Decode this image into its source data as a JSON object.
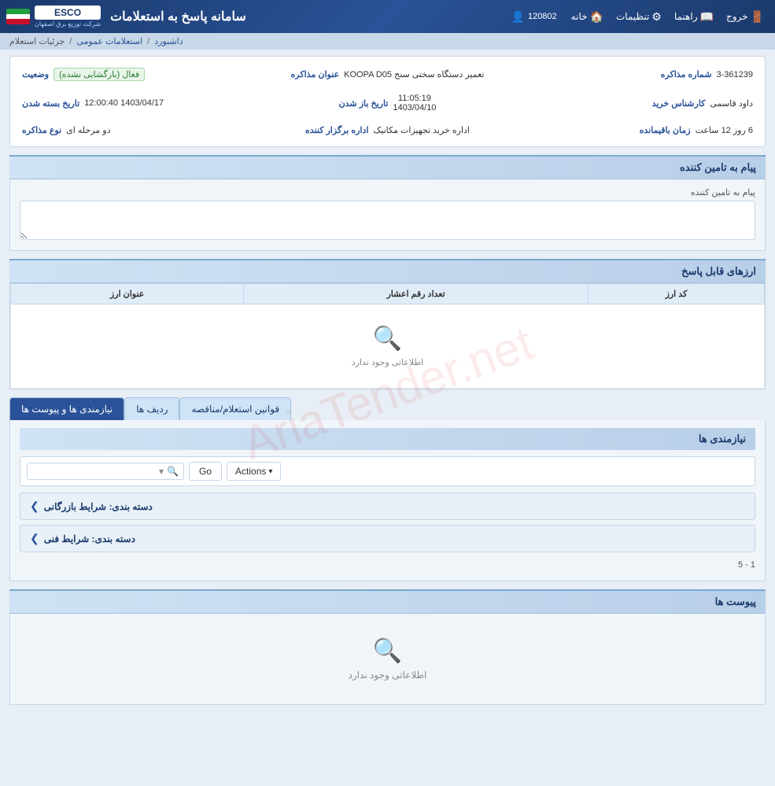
{
  "app": {
    "title": "سامانه پاسخ به استعلامات",
    "logo": "ESCO",
    "user_id": "120802"
  },
  "nav": {
    "home": "خانه",
    "settings": "تنظیمات",
    "guide": "راهنما",
    "exit": "خروج"
  },
  "breadcrumb": {
    "dashboard": "داشبورد",
    "general_inquiries": "استعلامات عمومی",
    "inquiry_details": "جزئیات استعلام"
  },
  "inquiry": {
    "number_label": "شماره مذاکره",
    "number_value": "3-361239",
    "title_label": "عنوان مذاکره",
    "title_value": "تعمیر دستگاه سختی سنج KOOPA D05",
    "status_label": "وضعیت",
    "status_value": "فعال (بازگشایی نشده)",
    "open_date_label": "تاریخ باز شدن",
    "open_date_value": "11:05:19\n1403/04/10",
    "close_date_label": "تاریخ بسته شدن",
    "close_date_value": "1403/04/17 12:00:40",
    "buyer_label": "کارشناس خرید",
    "buyer_value": "داود قاسمی",
    "org_label": "اداره برگزار کننده",
    "org_value": "اداره خرید تجهیزات مکانیک",
    "remaining_label": "زمان باقیمانده",
    "remaining_value": "6 روز 12 ساعت",
    "type_label": "نوع مذاکره",
    "type_value": "دو مرحله ای"
  },
  "sections": {
    "message_title": "پیام به تامین کننده",
    "message_label": "پیام به تامین کننده",
    "currencies_title": "ارزهای قابل پاسخ",
    "currencies_empty": "اطلاعاتی وجود ندارد",
    "currencies_cols": [
      "کد ارز",
      "تعداد رقم اعشار",
      "عنوان ارز"
    ],
    "requirements_title": "نیازمندی ها و پیوست ها",
    "requirements_sub": "نیازمندی ها",
    "attachments_title": "پیوست ها",
    "attachments_empty": "اطلاعاتی وجود ندارد",
    "pagination": "1 - 5"
  },
  "tabs": [
    {
      "id": "requirements",
      "label": "نیازمندی ها و پیوست ها",
      "active": true
    },
    {
      "id": "rows",
      "label": "ردیف ها"
    },
    {
      "id": "rules",
      "label": "قوانین استعلام/مناقصه"
    }
  ],
  "toolbar": {
    "actions_label": "Actions",
    "go_label": "Go",
    "search_placeholder": ""
  },
  "collapsible": [
    {
      "label": "دسته بندی: شرایط بازرگانی"
    },
    {
      "label": "دسته بندی: شرایط فنی"
    }
  ]
}
